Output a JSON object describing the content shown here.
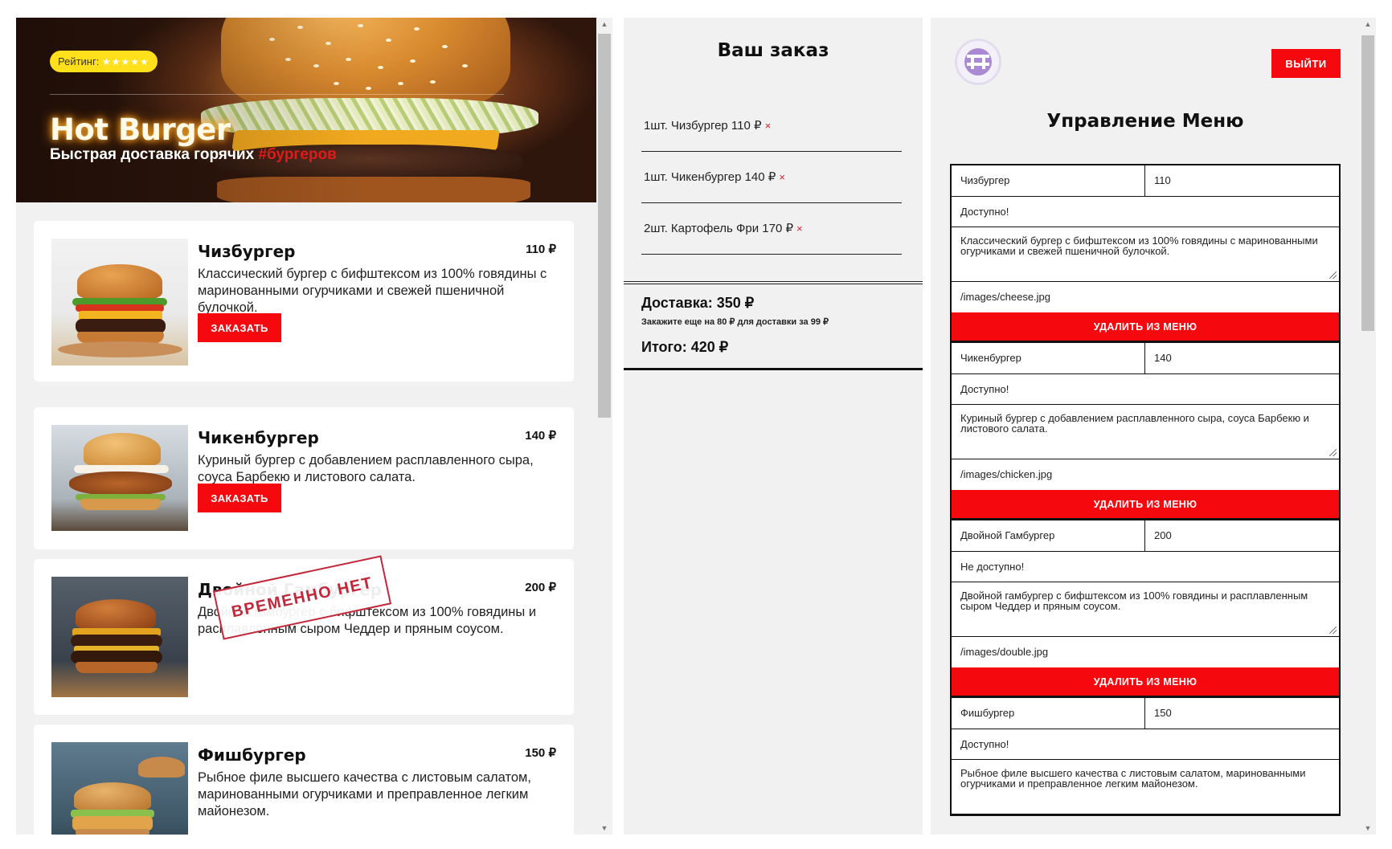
{
  "hero": {
    "rating_label": "Рейтинг:",
    "rating_stars": "★★★★★",
    "title": "Hot Burger",
    "subtitle": "Быстрая доставка горячих",
    "hashtag": "#бургеров"
  },
  "menu": {
    "order_button_label": "ЗАКАЗАТЬ",
    "unavailable_stamp": "ВРЕМЕННО НЕТ",
    "items": [
      {
        "name": "Чизбургер",
        "price": "110 ₽",
        "description": "Классический бургер с бифштексом из 100% говядины с маринованными огурчиками и свежей пшеничной булочкой.",
        "available": true
      },
      {
        "name": "Чикенбургер",
        "price": "140 ₽",
        "description": "Куриный бургер с добавлением расплавленного сыра, соуса Барбекю и листового салата.",
        "available": true
      },
      {
        "name": "Двойной Гамбургер",
        "price": "200 ₽",
        "description": "Двойной гамбургер с бифштексом из 100% говядины и расплавленным сыром Чеддер и пряным соусом.",
        "available": false
      },
      {
        "name": "Фишбургер",
        "price": "150 ₽",
        "description": "Рыбное филе высшего качества с листовым салатом, маринованными огурчиками и преправленное легким майонезом.",
        "available": true
      }
    ]
  },
  "order": {
    "title": "Ваш заказ",
    "items": [
      {
        "text": "1шт. Чизбургер 110 ₽",
        "remove": "×"
      },
      {
        "text": "1шт. Чикенбургер 140 ₽",
        "remove": "×"
      },
      {
        "text": "2шт. Картофель Фри 170 ₽",
        "remove": "×"
      }
    ],
    "delivery": "Доставка: 350 ₽",
    "delivery_note": "Закажите еще на 80 ₽ для доставки за 99 ₽",
    "total": "Итого: 420 ₽"
  },
  "admin": {
    "logout_label": "ВЫЙТИ",
    "title": "Управление Меню",
    "delete_label": "УДАЛИТЬ ИЗ МЕНЮ",
    "items": [
      {
        "name": "Чизбургер",
        "price": "110",
        "status": "Доступно!",
        "description": "Классический бургер с бифштексом из 100% говядины с маринованными огурчиками и свежей пшеничной булочкой.",
        "image": "/images/cheese.jpg"
      },
      {
        "name": "Чикенбургер",
        "price": "140",
        "status": "Доступно!",
        "description": "Куриный бургер с добавлением расплавленного сыра, соуса Барбекю и листового салата.",
        "image": "/images/chicken.jpg"
      },
      {
        "name": "Двойной Гамбургер",
        "price": "200",
        "status": "Не доступно!",
        "description": "Двойной гамбургер с бифштексом из 100% говядины и расплавленным сыром Чеддер и пряным соусом.",
        "image": "/images/double.jpg"
      },
      {
        "name": "Фишбургер",
        "price": "150",
        "status": "Доступно!",
        "description": "Рыбное филе высшего качества с листовым салатом, маринованными огурчиками и преправленное легким майонезом.",
        "image": ""
      }
    ]
  },
  "colors": {
    "accent_red": "#f5080e",
    "rating_yellow": "#ffe01b",
    "panel_bg": "#f1f1f1"
  }
}
